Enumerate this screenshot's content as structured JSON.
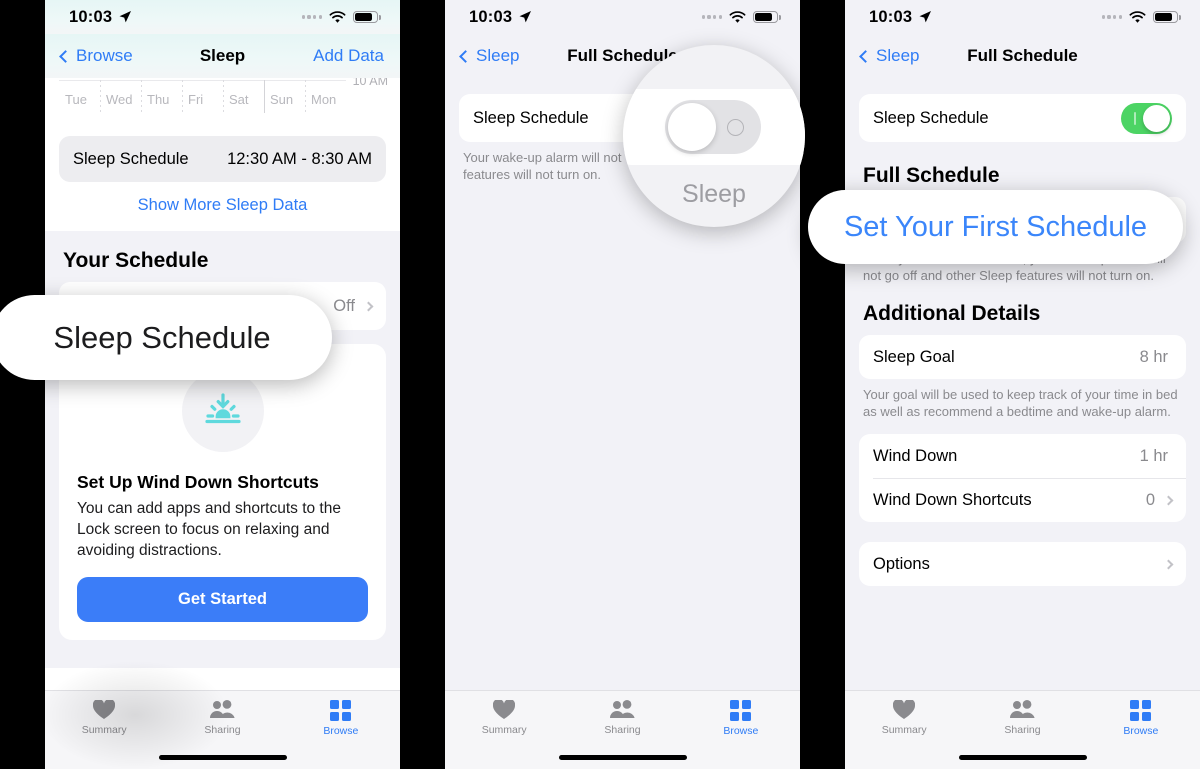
{
  "status_bar": {
    "time": "10:03",
    "location_icon": "location-arrow-icon",
    "wifi_icon": "wifi-icon",
    "battery_icon": "battery-icon"
  },
  "panel1": {
    "nav": {
      "back_label": "Browse",
      "title": "Sleep",
      "action_label": "Add Data"
    },
    "chart": {
      "y_label": "10 AM",
      "days": [
        "Tue",
        "Wed",
        "Thu",
        "Fri",
        "Sat",
        "Sun",
        "Mon"
      ]
    },
    "schedule_summary": {
      "label": "Sleep Schedule",
      "value": "12:30 AM - 8:30 AM"
    },
    "show_more_link": "Show More Sleep Data",
    "section_header": "Your Schedule",
    "schedule_row": {
      "label": "Sleep Schedule",
      "value": "Off"
    },
    "promo": {
      "icon": "sunset-wind-down-icon",
      "title": "Set Up Wind Down Shortcuts",
      "body": "You can add apps and shortcuts to the Lock screen to focus on relaxing and avoiding distractions.",
      "cta": "Get Started"
    },
    "callout": {
      "text": "Sleep Schedule"
    }
  },
  "panel2": {
    "nav": {
      "back_label": "Sleep",
      "title": "Full Schedule"
    },
    "schedule_row": {
      "label": "Sleep Schedule"
    },
    "footnote": "Your wake-up alarm will not\nfeatures will not turn on.",
    "callout": {
      "word": "Sleep",
      "toggle_state": "off"
    }
  },
  "panel3": {
    "nav": {
      "back_label": "Sleep",
      "title": "Full Schedule"
    },
    "schedule_row": {
      "label": "Sleep Schedule",
      "toggle_state": "on"
    },
    "section_header": "Full Schedule",
    "callout": {
      "text": "Set Your First Schedule"
    },
    "footnote": "On days without a schedule, your wake-up alarm will not go off and other Sleep features will not turn on.",
    "details_header": "Additional Details",
    "rows": [
      {
        "label": "Sleep Goal",
        "value": "8 hr",
        "chevron": false
      },
      {
        "label": "Wind Down",
        "value": "1 hr",
        "chevron": false
      },
      {
        "label": "Wind Down Shortcuts",
        "value": "0",
        "chevron": true
      },
      {
        "label": "Options",
        "value": "",
        "chevron": true
      }
    ],
    "goal_footnote": "Your goal will be used to keep track of your time in bed as well as recommend a bedtime and wake-up alarm."
  },
  "tabbar": {
    "tabs": [
      {
        "label": "Summary",
        "icon": "heart-icon",
        "active": false
      },
      {
        "label": "Sharing",
        "icon": "people-icon",
        "active": false
      },
      {
        "label": "Browse",
        "icon": "grid-icon",
        "active": true
      }
    ]
  },
  "colors": {
    "accent_blue": "#2f7cf6",
    "cta_blue": "#3b7df8",
    "toggle_green": "#4cd464",
    "sunset_teal": "#5fd9dd",
    "gray_text": "#8a8a8e"
  }
}
